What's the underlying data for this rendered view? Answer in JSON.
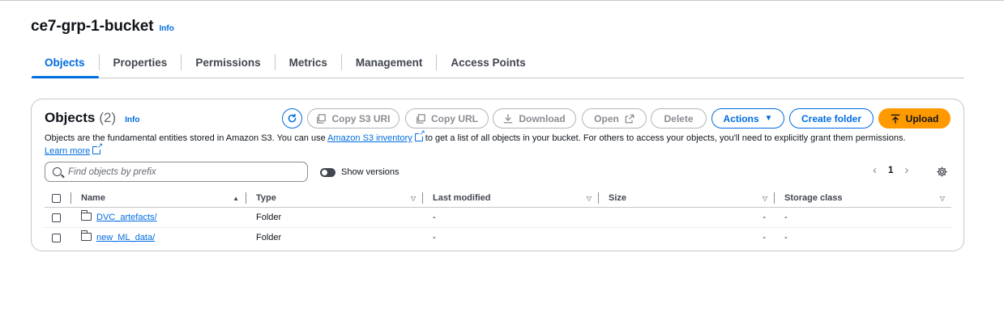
{
  "bucket": {
    "name": "ce7-grp-1-bucket",
    "info": "Info"
  },
  "tabs": [
    {
      "label": "Objects",
      "active": true
    },
    {
      "label": "Properties"
    },
    {
      "label": "Permissions"
    },
    {
      "label": "Metrics"
    },
    {
      "label": "Management"
    },
    {
      "label": "Access Points"
    }
  ],
  "objects_panel": {
    "title": "Objects",
    "count": "(2)",
    "info": "Info",
    "buttons": {
      "copy_s3_uri": "Copy S3 URI",
      "copy_url": "Copy URL",
      "download": "Download",
      "open": "Open",
      "delete": "Delete",
      "actions": "Actions",
      "create_folder": "Create folder",
      "upload": "Upload"
    },
    "description": {
      "part1": "Objects are the fundamental entities stored in Amazon S3. You can use ",
      "link_inventory": "Amazon S3 inventory",
      "part2": " to get a list of all objects in your bucket. For others to access your objects, you'll need to explicitly grant them permissions.",
      "link_learn_more": "Learn more"
    },
    "search_placeholder": "Find objects by prefix",
    "show_versions": "Show versions",
    "page": "1",
    "columns": [
      "Name",
      "Type",
      "Last modified",
      "Size",
      "Storage class"
    ],
    "rows": [
      {
        "name": "DVC_artefacts/",
        "type": "Folder",
        "last_modified": "-",
        "size": "-",
        "storage_class": "-"
      },
      {
        "name": "new_ML_data/",
        "type": "Folder",
        "last_modified": "-",
        "size": "-",
        "storage_class": "-"
      }
    ]
  },
  "colors": {
    "accent": "#006ce0",
    "upload": "#ff9900",
    "text": "#0f141a",
    "border": "#c6c6cd"
  }
}
